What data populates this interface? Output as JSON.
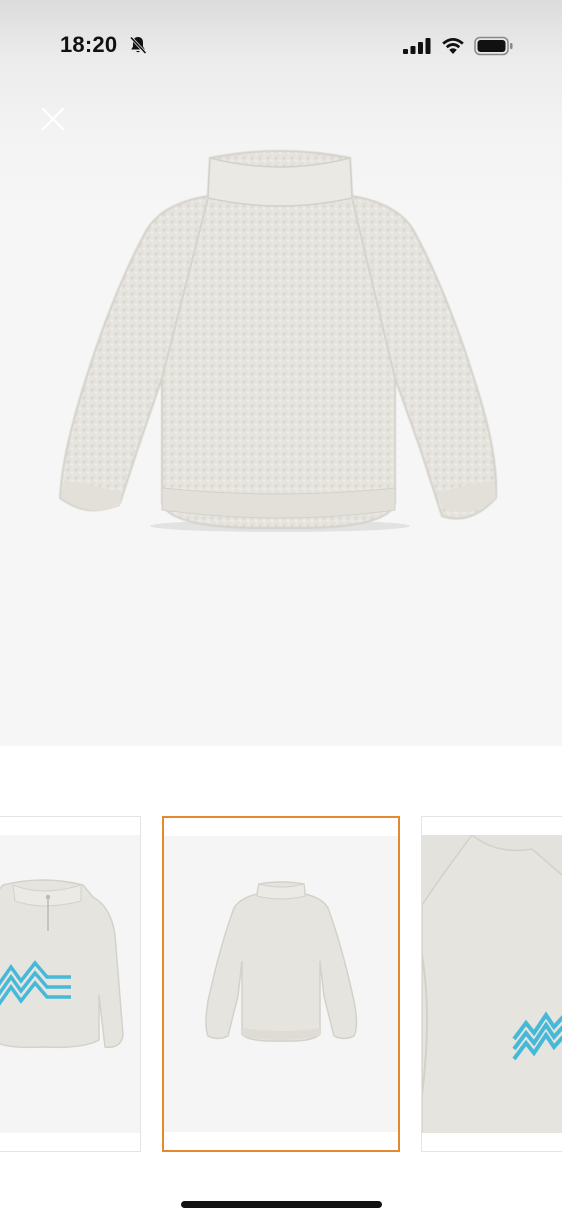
{
  "status_bar": {
    "time": "18:20",
    "icons": [
      "bell-slash-icon",
      "cellular-signal-icon",
      "wifi-icon",
      "battery-icon"
    ]
  },
  "viewer": {
    "close_icon": "close-icon",
    "main_image": "fleece-pullover-front",
    "thumbnails": [
      {
        "image": "fleece-pullover-quarter-zip-logo",
        "selected": false
      },
      {
        "image": "fleece-pullover-back",
        "selected": true
      },
      {
        "image": "fleece-pullover-logo-closeup",
        "selected": false
      }
    ]
  },
  "colors": {
    "selected_border": "#e5892e",
    "fleece": "#e6e4de",
    "logo_accent": "#46b8d8"
  }
}
